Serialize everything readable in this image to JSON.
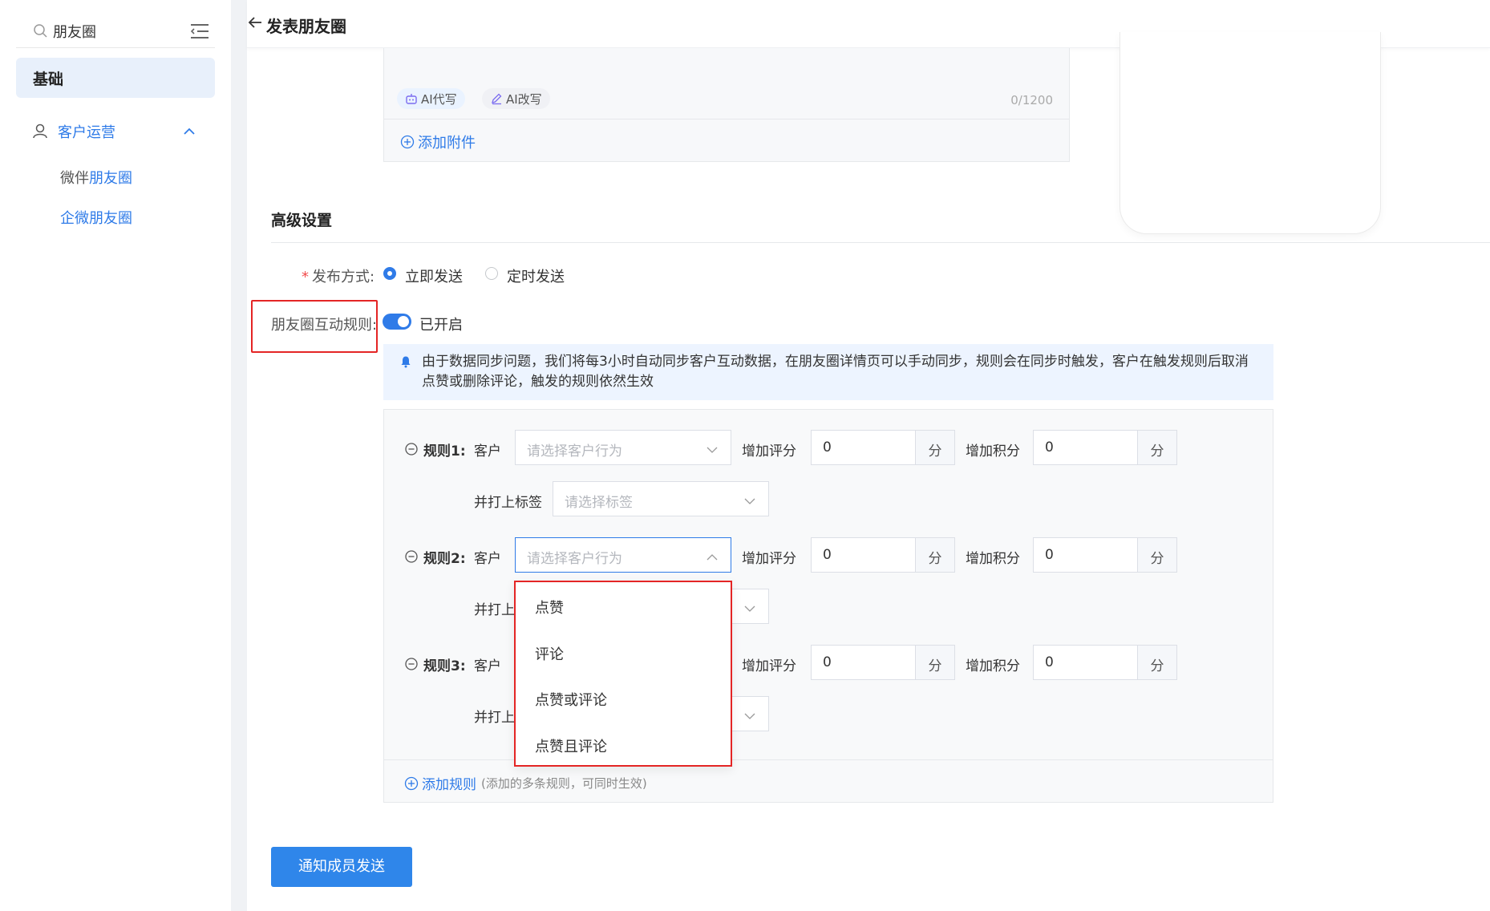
{
  "sidebar": {
    "search_text": "朋友圈",
    "basic_label": "基础",
    "group_label": "客户运营",
    "sub1_prefix": "微伴",
    "sub1_highlight": "朋友圈",
    "sub2_label": "企微朋友圈"
  },
  "header": {
    "title": "发表朋友圈"
  },
  "editor": {
    "ai_write": "AI代写",
    "ai_rewrite": "AI改写",
    "counter": "0/1200",
    "add_attachment": "添加附件"
  },
  "advanced": {
    "section_title": "高级设置",
    "publish_label": "发布方式:",
    "publish_required": "*",
    "publish_options": [
      "立即发送",
      "定时发送"
    ],
    "publish_selected": "立即发送",
    "interaction_label": "朋友圈互动规则:",
    "interaction_status": "已开启",
    "interaction_enabled": true,
    "notice": "由于数据同步问题，我们将每3小时自动同步客户互动数据，在朋友圈详情页可以手动同步，规则会在同步时触发，客户在触发规则后取消点赞或删除评论，触发的规则依然生效"
  },
  "rules": {
    "customer_word": "客户",
    "behavior_placeholder": "请选择客户行为",
    "add_score_label": "增加评分",
    "add_points_label": "增加积分",
    "unit": "分",
    "tag_label": "并打上标签",
    "tag_label_partial": "并打上",
    "tag_placeholder": "请选择标签",
    "items": [
      {
        "title": "规则1:",
        "score": "0",
        "points": "0"
      },
      {
        "title": "规则2:",
        "score": "0",
        "points": "0"
      },
      {
        "title": "规则3:",
        "score": "0",
        "points": "0"
      }
    ],
    "dropdown_options": [
      "点赞",
      "评论",
      "点赞或评论",
      "点赞且评论"
    ],
    "add_rule": "添加规则",
    "add_rule_hint": "(添加的多条规则，可同时生效)"
  },
  "submit_label": "通知成员发送",
  "colors": {
    "primary": "#2f7be8",
    "highlight_box": "#e42525",
    "notice_bg": "#edf4ff"
  }
}
